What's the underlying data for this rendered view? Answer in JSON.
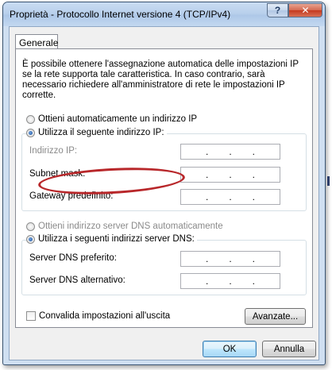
{
  "window": {
    "title": "Proprietà - Protocollo Internet versione 4 (TCP/IPv4)",
    "help_label": "?",
    "close_label": "✕"
  },
  "tab": {
    "label": "Generale"
  },
  "description": "È possibile ottenere l'assegnazione automatica delle impostazioni IP se la rete supporta tale caratteristica. In caso contrario, sarà necessario richiedere all'amministratore di rete le impostazioni IP corrette.",
  "ip": {
    "auto_label": "Ottieni automaticamente un indirizzo IP",
    "auto_selected": false,
    "manual_label": "Utilizza il seguente indirizzo IP:",
    "manual_selected": true,
    "fields": [
      {
        "label": "Indirizzo IP:",
        "value": ". . ."
      },
      {
        "label": "Subnet mask:",
        "value": ". . ."
      },
      {
        "label": "Gateway predefinito:",
        "value": ". . ."
      }
    ]
  },
  "dns": {
    "auto_label": "Ottieni indirizzo server DNS automaticamente",
    "auto_selected": false,
    "manual_label": "Utilizza i seguenti indirizzi server DNS:",
    "manual_selected": true,
    "fields": [
      {
        "label": "Server DNS preferito:",
        "value": ". . ."
      },
      {
        "label": "Server DNS alternativo:",
        "value": ". . ."
      }
    ]
  },
  "validate": {
    "label": "Convalida impostazioni all'uscita",
    "checked": false
  },
  "buttons": {
    "advanced": "Avanzate...",
    "ok": "OK",
    "cancel": "Annulla"
  },
  "colors": {
    "highlight_ring": "#b8272a",
    "title_bar": "#b9d0ec",
    "close": "#c4391f"
  }
}
